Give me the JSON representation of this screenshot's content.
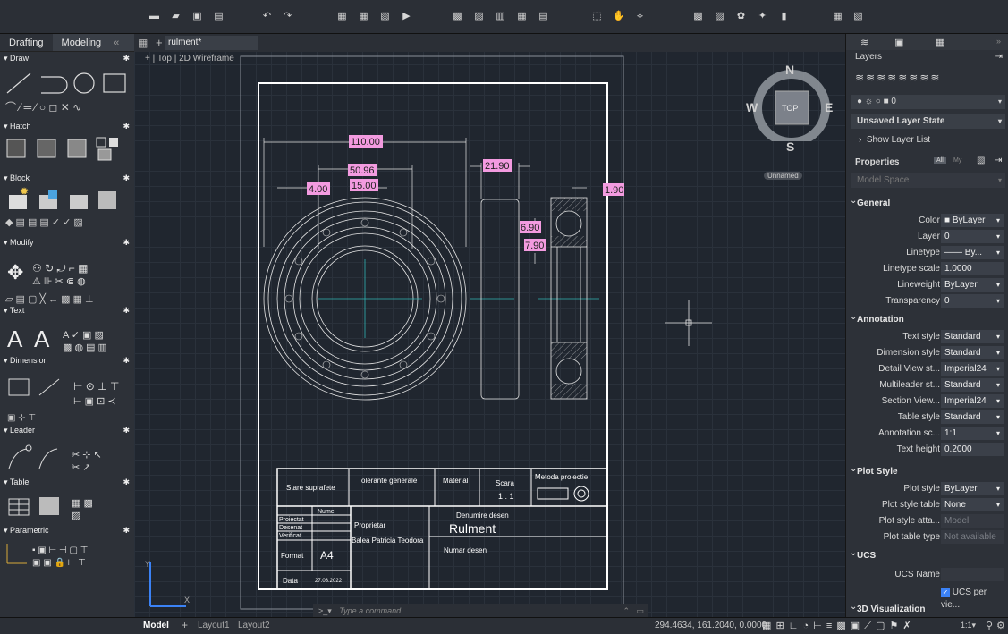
{
  "left_panel": {
    "tabs": [
      "Drafting",
      "Modeling"
    ],
    "collapse": "«",
    "groups": [
      "Draw",
      "Hatch",
      "Block",
      "Modify",
      "Text",
      "Dimension",
      "Leader",
      "Table",
      "Parametric"
    ],
    "bottom_plus": "+"
  },
  "doc": {
    "tab_name": "rulment*",
    "view_label": "Top | 2D Wireframe",
    "view_prefix": "+ |"
  },
  "viewcube": {
    "n": "N",
    "s": "S",
    "e": "E",
    "w": "W",
    "top": "TOP",
    "ucs": "Unnamed"
  },
  "drawing": {
    "dims": {
      "d110": "110.00",
      "d5096": "50.96",
      "d2190": "21.90",
      "d400": "4.00",
      "d1500": "15.00",
      "d190": "1.90",
      "d690": "6.90",
      "d790": "7.90"
    },
    "title_block": {
      "stare": "Stare suprafete",
      "tolerante": "Tolerante generale",
      "material": "Material",
      "scara": "Scara",
      "scara_val": "1 : 1",
      "metoda": "Metoda proiectie",
      "nume": "Nume",
      "proiectat": "Proiectat",
      "desenat": "Desenat",
      "verificat": "Verificat",
      "format": "Format",
      "format_val": "A4",
      "data": "Data",
      "data_val": "27.03.2022",
      "proprietar": "Proprietar",
      "proprietar_val": "Balea Patricia Teodora",
      "denumire": "Denumire desen",
      "denumire_val": "Rulment",
      "numar": "Numar desen"
    }
  },
  "command": {
    "prompt": ">_▾",
    "placeholder": "Type a command"
  },
  "status": {
    "model": "Model",
    "layout1": "Layout1",
    "layout2": "Layout2",
    "coords": "294.4634, 161.2040, 0.0000",
    "scale": "1:1▾"
  },
  "right_panel": {
    "layers_title": "Layers",
    "layer_current": "0",
    "layer_state": "Unsaved Layer State",
    "show_layer_list": "Show Layer List",
    "properties_title": "Properties",
    "filter_all": "All",
    "filter_my": "My",
    "space": "Model Space",
    "sections": {
      "general": "General",
      "annotation": "Annotation",
      "plot": "Plot Style",
      "ucs": "UCS",
      "viz": "3D Visualization"
    },
    "general": [
      {
        "label": "Color",
        "value": "■ ByLayer"
      },
      {
        "label": "Layer",
        "value": "0"
      },
      {
        "label": "Linetype",
        "value": "—— By..."
      },
      {
        "label": "Linetype scale",
        "value": "1.0000"
      },
      {
        "label": "Lineweight",
        "value": "ByLayer"
      },
      {
        "label": "Transparency",
        "value": "0"
      }
    ],
    "annotation": [
      {
        "label": "Text style",
        "value": "Standard"
      },
      {
        "label": "Dimension style",
        "value": "Standard"
      },
      {
        "label": "Detail View st...",
        "value": "Imperial24"
      },
      {
        "label": "Multileader st...",
        "value": "Standard"
      },
      {
        "label": "Section View...",
        "value": "Imperial24"
      },
      {
        "label": "Table style",
        "value": "Standard"
      },
      {
        "label": "Annotation sc...",
        "value": "1:1"
      },
      {
        "label": "Text height",
        "value": "0.2000"
      }
    ],
    "plot": [
      {
        "label": "Plot style",
        "value": "ByLayer"
      },
      {
        "label": "Plot style table",
        "value": "None"
      },
      {
        "label": "Plot style atta...",
        "value": "Model"
      },
      {
        "label": "Plot table type",
        "value": "Not available"
      }
    ],
    "ucs_name_label": "UCS Name",
    "ucs_per_view": "UCS per vie..."
  }
}
